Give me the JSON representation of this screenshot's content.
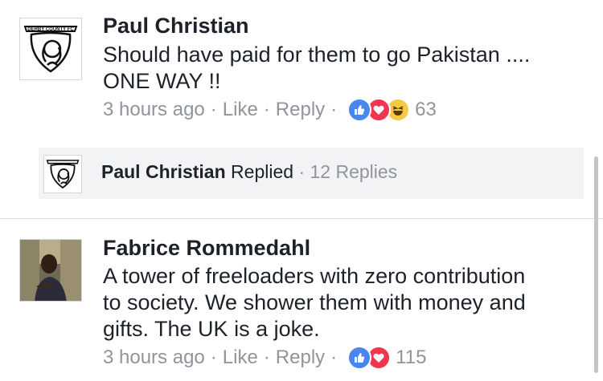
{
  "comments": [
    {
      "author": "Paul Christian",
      "avatar_icon": "derby-county-fc-crest-icon",
      "avatar_text": "DERBY COUNTY FC",
      "text_line1": "Should have paid for them to go Pakistan ....",
      "text_line2": "ONE WAY !!",
      "time": "3 hours ago",
      "like_label": "Like",
      "reply_label": "Reply",
      "reactions": [
        "like-icon",
        "love-icon",
        "haha-icon"
      ],
      "reaction_count": "63"
    },
    {
      "author": "Fabrice Rommedahl",
      "avatar_icon": "profile-photo",
      "text_line1": "A tower of freeloaders with zero contribution",
      "text_line2": "to society. We shower them with money and",
      "text_line3": "gifts. The UK is a joke.",
      "time": "3 hours ago",
      "like_label": "Like",
      "reply_label": "Reply",
      "reactions": [
        "like-icon",
        "love-icon"
      ],
      "reaction_count": "115"
    }
  ],
  "reply_summary": {
    "author": "Paul Christian",
    "action": "Replied",
    "count_label": "12 Replies"
  },
  "colors": {
    "text": "#1d2129",
    "meta": "#90949c",
    "like": "#4a86f0",
    "love": "#f0364e",
    "haha": "#f7c846",
    "reply_bg": "#f2f3f5"
  }
}
